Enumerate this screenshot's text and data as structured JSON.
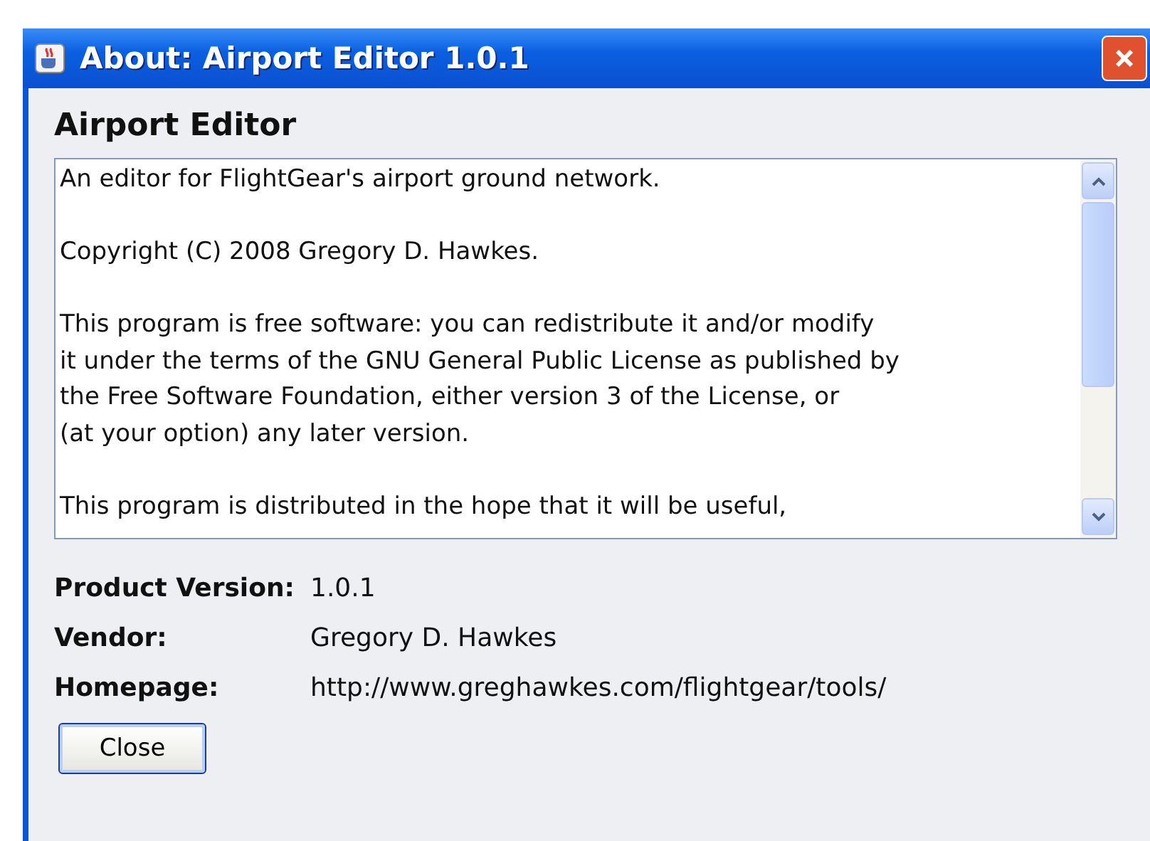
{
  "window": {
    "title": "About: Airport Editor 1.0.1"
  },
  "heading": "Airport Editor",
  "description": [
    "An editor for FlightGear's airport ground network.",
    "Copyright (C) 2008 Gregory D. Hawkes.",
    "This program is free software: you can redistribute it and/or modify\nit under the terms of the GNU General Public License as published by\nthe Free Software Foundation, either version 3 of the License, or\n(at your option) any later version.",
    "This program is distributed in the hope that it will be useful,"
  ],
  "info": [
    {
      "label": "Product Version:",
      "value": "1.0.1"
    },
    {
      "label": "Vendor:",
      "value": "Gregory D. Hawkes"
    },
    {
      "label": "Homepage:",
      "value": "http://www.greghawkes.com/flightgear/tools/"
    }
  ],
  "buttons": [
    "Close"
  ]
}
